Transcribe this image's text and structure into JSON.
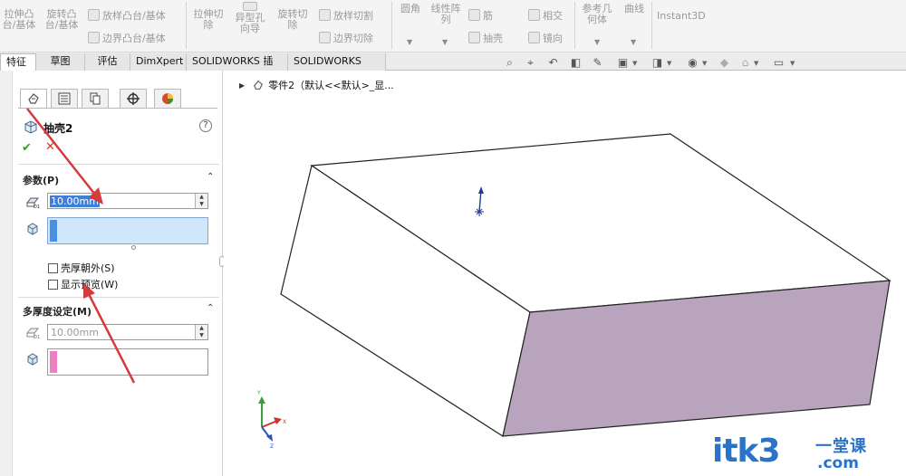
{
  "ribbon": {
    "extrude_boss": [
      "拉伸凸",
      "台/基体"
    ],
    "revolve_boss": [
      "旋转凸",
      "台/基体"
    ],
    "loft_boss": "放样凸台/基体",
    "boundary_boss": "边界凸台/基体",
    "extrude_cut": [
      "拉伸切",
      "除"
    ],
    "hole_wizard": [
      "异型孔",
      "向导"
    ],
    "revolve_cut": [
      "旋转切",
      "除"
    ],
    "loft_cut": "放样切割",
    "boundary_cut": "边界切除",
    "fillet": "圆角",
    "linear_pattern": [
      "线性阵",
      "列"
    ],
    "rib": "筋",
    "shell": "抽壳",
    "wrap": "相交",
    "mirror": "镜向",
    "ref_geometry": [
      "参考几",
      "何体"
    ],
    "curves": "曲线",
    "instant3d": "Instant3D"
  },
  "tabs": [
    {
      "label": "特征",
      "active": true
    },
    {
      "label": "草图"
    },
    {
      "label": "评估"
    },
    {
      "label": "DimXpert"
    },
    {
      "label": "SOLIDWORKS 插件"
    },
    {
      "label": "SOLIDWORKS MBD"
    }
  ],
  "property_manager": {
    "title": "抽壳2",
    "help": "?",
    "ok": "✔",
    "cancel": "✕",
    "parameters": {
      "title": "参数(P)",
      "thickness": "10.00mm",
      "preview_checkbox_outward": "壳厚朝外(S)",
      "preview_checkbox_show": "显示预览(W)"
    },
    "multi_thickness": {
      "title": "多厚度设定(M)",
      "thickness": "10.00mm"
    }
  },
  "tree": {
    "item": "零件2（默认<<默认>_显..."
  },
  "watermark": {
    "main": "itk3",
    "cn": "一堂课",
    "en": ".com"
  },
  "colors": {
    "accent_blue": "#3e7fd8",
    "face_pink": "#b8a5bd",
    "focus_box": "#cfe6fb",
    "strip_blue": "#4a90e2",
    "strip_pink": "#ee7fc0",
    "arrow_red": "#d63b3b",
    "watermark": "#2a73c9"
  }
}
